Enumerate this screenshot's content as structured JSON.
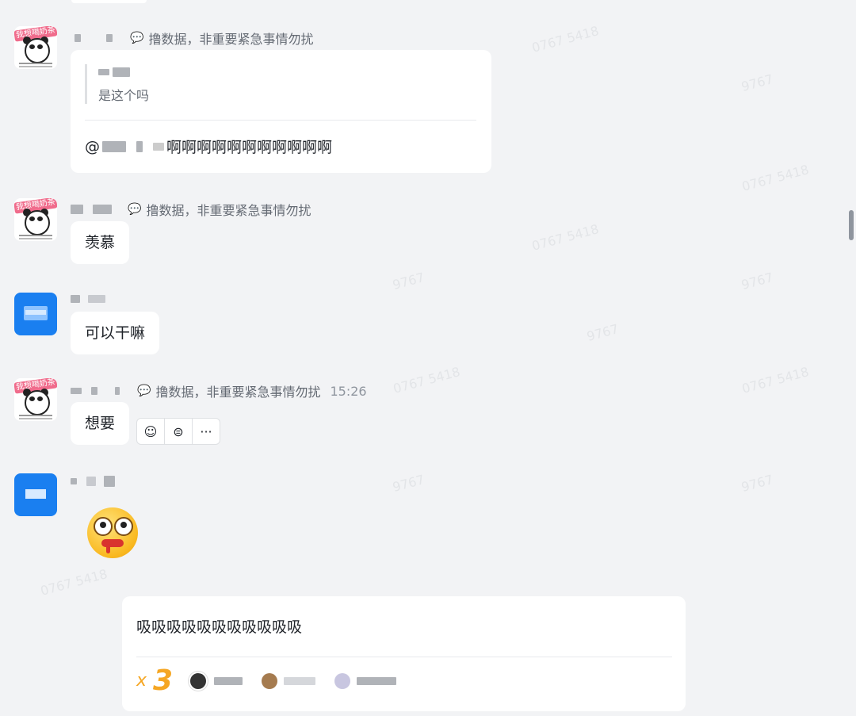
{
  "watermarks": [
    "0767 5418",
    "9767",
    "0767 5418",
    "9767",
    "0767 5418",
    "9767",
    "0767 5418",
    "9767",
    "0767 5418",
    "9767",
    "0767 5418",
    "9767"
  ],
  "messages": [
    {
      "avatar": "panda-meme",
      "avatar_text": "我想喝奶茶",
      "status": "撸数据，非重要紧急事情勿扰",
      "quote_text": "是这个吗",
      "mention_prefix": "@",
      "mention_text": "啊啊啊啊啊啊啊啊啊啊啊"
    },
    {
      "avatar": "panda-meme",
      "avatar_text": "我想喝奶茶",
      "status": "撸数据，非重要紧急事情勿扰",
      "text": "羡慕"
    },
    {
      "avatar": "blue-logo",
      "text": "可以干嘛"
    },
    {
      "avatar": "panda-meme",
      "avatar_text": "我想喝奶茶",
      "status": "撸数据，非重要紧急事情勿扰",
      "time": "15:26",
      "text": "想要"
    },
    {
      "avatar": "blue-logo",
      "emoji": "drooling-face-emoji"
    }
  ],
  "hover_actions": [
    "emoji-reaction-icon",
    "reply-icon",
    "more-icon"
  ],
  "hover_glyphs": [
    "☺",
    "⊜",
    "···"
  ],
  "reply_card": {
    "text": "吸吸吸吸吸吸吸吸吸吸吸",
    "reaction_x": "x",
    "reaction_count": "3"
  },
  "colors": {
    "background": "#f2f3f5",
    "bubble": "#ffffff",
    "accent_blue": "#1a7ff0",
    "reaction_orange": "#f5a623"
  }
}
